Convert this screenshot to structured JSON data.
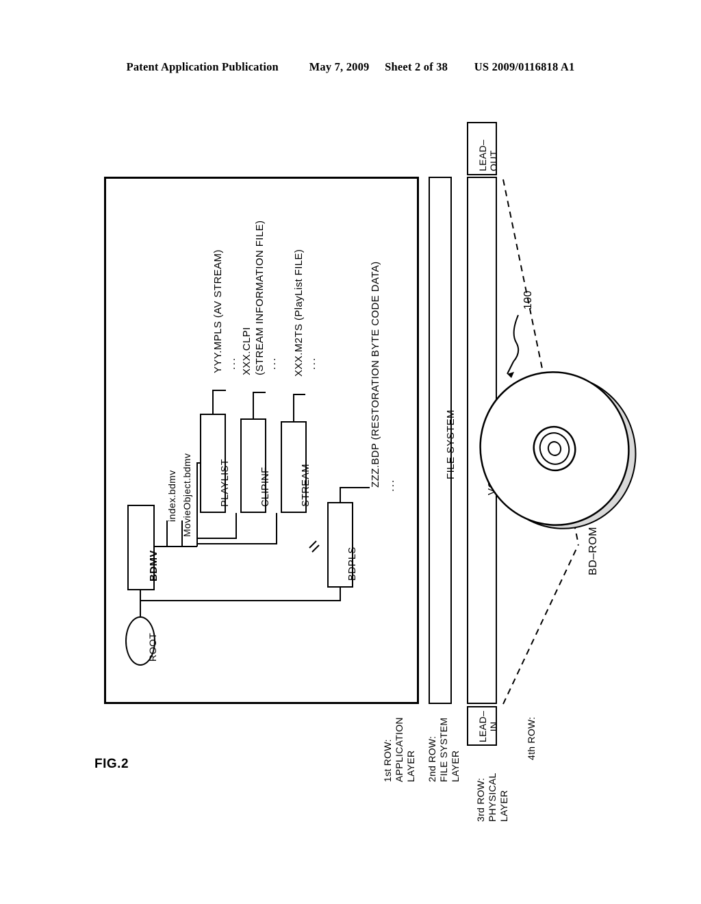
{
  "header": {
    "left": "Patent Application Publication",
    "date": "May 7, 2009",
    "sheet": "Sheet 2 of 38",
    "number": "US 2009/0116818 A1"
  },
  "figure": {
    "label": "FIG.2",
    "rows": [
      {
        "id": "row1",
        "text": "1st ROW:\nAPPLICATION\nLAYER"
      },
      {
        "id": "row2",
        "text": "2nd ROW:\nFILE SYSTEM\nLAYER"
      },
      {
        "id": "row3",
        "text": "3rd ROW:\nPHYSICAL\nLAYER"
      },
      {
        "id": "row4",
        "text": "4th ROW:"
      }
    ],
    "nodes": {
      "root": "ROOT",
      "bdmv": "BDMV",
      "playlist": "PLAYLIST",
      "clipinf": "CLIPINF",
      "stream": "STREAM",
      "bdpls": "BDPLS"
    },
    "edge_labels": {
      "index": "index.bdmv",
      "movieobject": "MovieObject.bdmv"
    },
    "leaf_labels": {
      "mpls": "YYY.MPLS (AV STREAM)",
      "clpi_1": "XXX.CLPI",
      "clpi_2": "(STREAM INFORMATION FILE)",
      "m2ts": "XXX.M2TS (PlayList FILE)",
      "bdp": "ZZZ.BDP (RESTORATION BYTE CODE DATA)"
    },
    "ellipsis": "...",
    "bands": {
      "file_system": "FILE SYSTEM",
      "volume_area": "VOLUME AREA",
      "lead_in": "LEAD–\nIN",
      "lead_out": "LEAD–\nOUT"
    },
    "disc": {
      "callout": "100",
      "caption": "BD–ROM"
    }
  }
}
